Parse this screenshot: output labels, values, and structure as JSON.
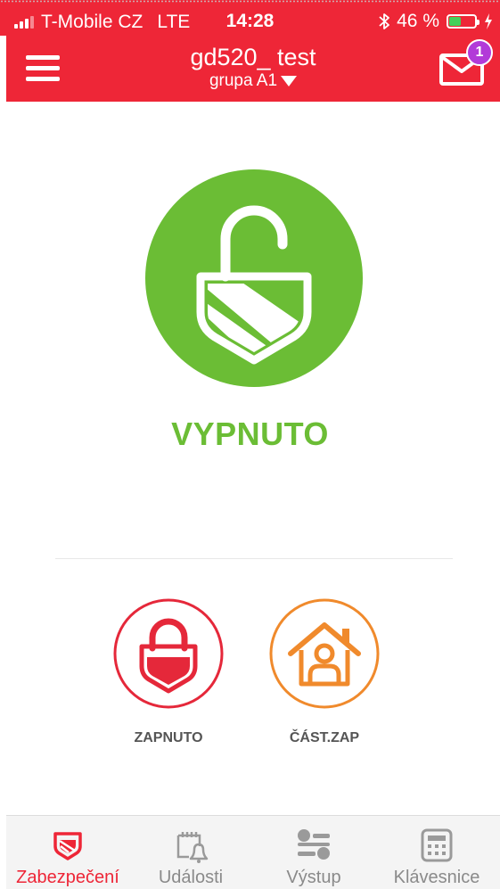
{
  "status_bar": {
    "carrier": "T-Mobile CZ",
    "network": "LTE",
    "time": "14:28",
    "battery_percent": "46 %",
    "battery_level": 0.46
  },
  "header": {
    "title": "gd520_ test",
    "subtitle": "grupa A1",
    "mail_badge": "1"
  },
  "main": {
    "state_label": "VYPNUTO",
    "state_color": "#6bbd35"
  },
  "actions": [
    {
      "label": "ZAPNUTO",
      "color": "#e5283a"
    },
    {
      "label": "ČÁST.ZAP",
      "color": "#f08a2c"
    }
  ],
  "tabs": [
    {
      "label": "Zabezpečení",
      "icon": "shield-icon",
      "active": true
    },
    {
      "label": "Události",
      "icon": "calendar-bell-icon",
      "active": false
    },
    {
      "label": "Výstup",
      "icon": "output-toggles-icon",
      "active": false
    },
    {
      "label": "Klávesnice",
      "icon": "keypad-icon",
      "active": false
    }
  ],
  "colors": {
    "brand_red": "#ee2637",
    "disarmed_green": "#6bbd35",
    "partial_orange": "#f08a2c",
    "badge_purple": "#b23ad8"
  }
}
